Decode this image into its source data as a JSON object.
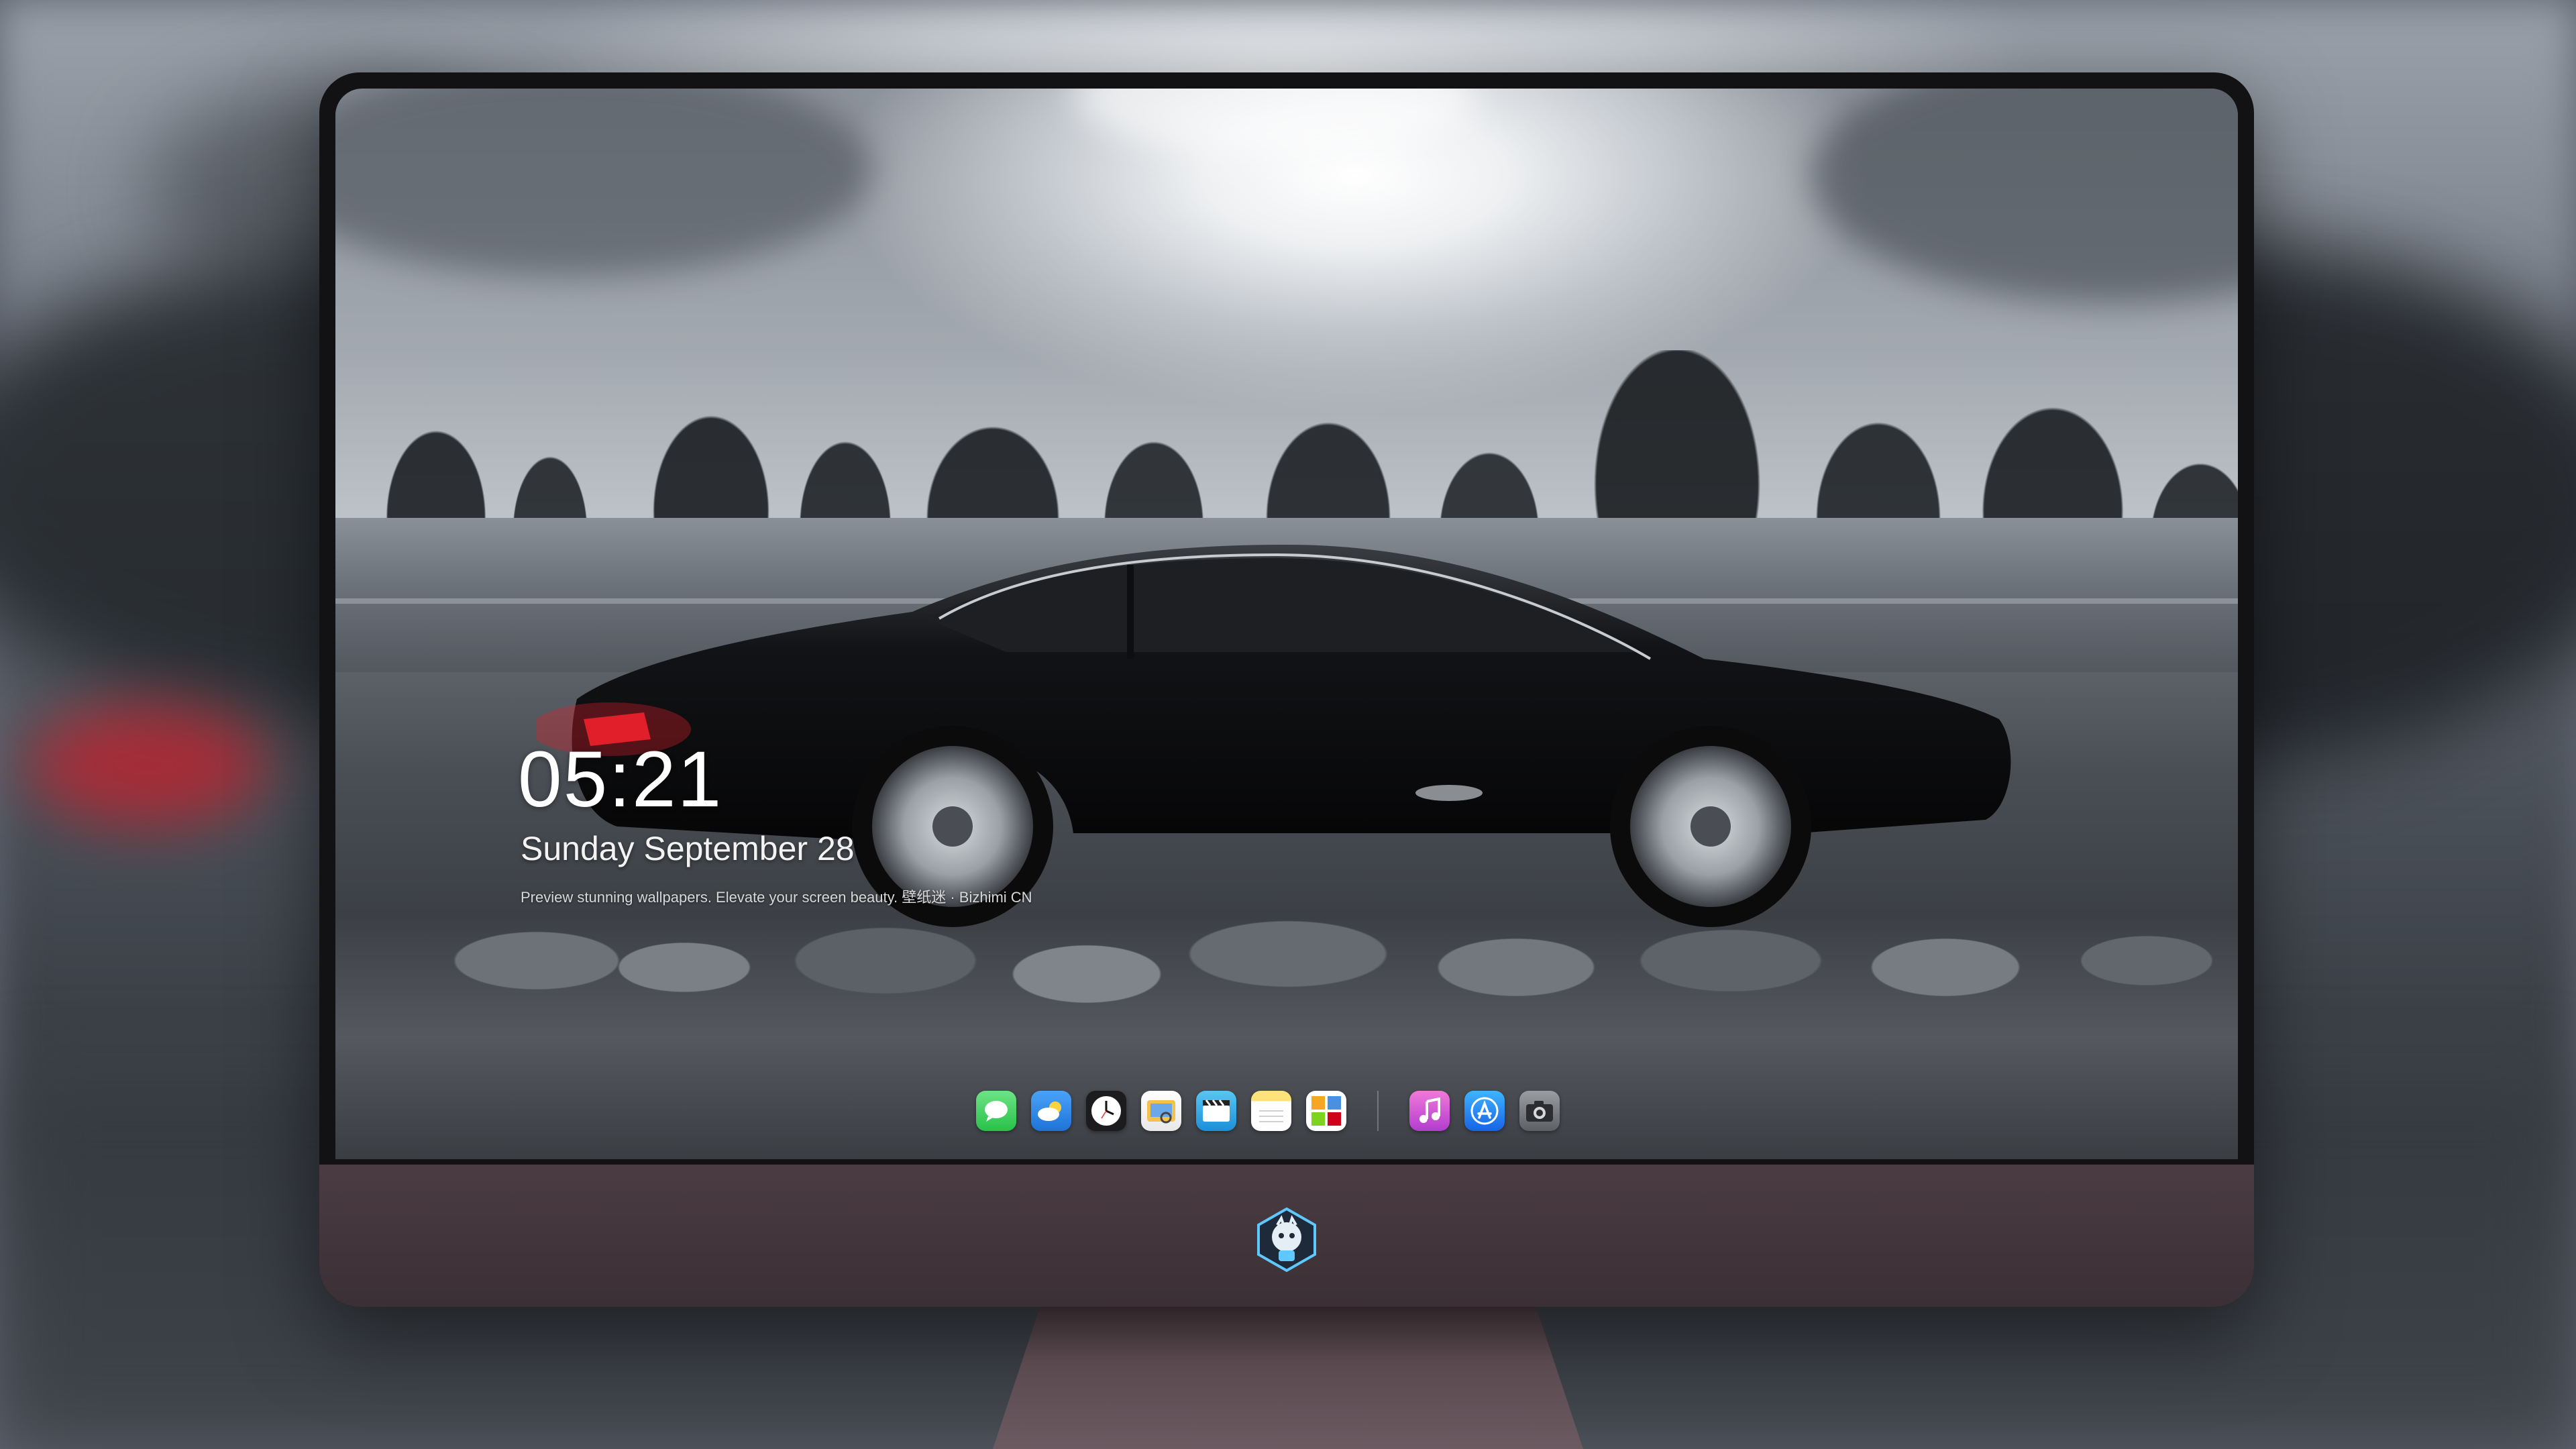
{
  "lock_screen": {
    "time": "05:21",
    "date": "Sunday September 28",
    "caption": "Preview stunning wallpapers. Elevate your screen beauty. 壁纸迷 · Bizhimi CN"
  },
  "dock": {
    "apps": [
      {
        "name": "messages-icon",
        "color": "#2fd158"
      },
      {
        "name": "weather-icon",
        "color": "#3a8ff0"
      },
      {
        "name": "clock-icon",
        "color": "#1c1c1e"
      },
      {
        "name": "preview-icon",
        "color": "#f2c14e"
      },
      {
        "name": "videos-icon",
        "color": "#3aa7e8"
      },
      {
        "name": "notes-icon",
        "color": "#ffd84a"
      },
      {
        "name": "photo-booth-icon",
        "color": "#8bc34a"
      },
      {
        "name": "music-icon",
        "color": "#e458c9"
      },
      {
        "name": "app-store-icon",
        "color": "#1b8df0"
      },
      {
        "name": "camera-icon",
        "color": "#5c5f64"
      }
    ]
  },
  "colors": {
    "monitor_bezel": "#121214",
    "monitor_chin": "#4a3c42",
    "accent_taillight": "#e0202c"
  }
}
